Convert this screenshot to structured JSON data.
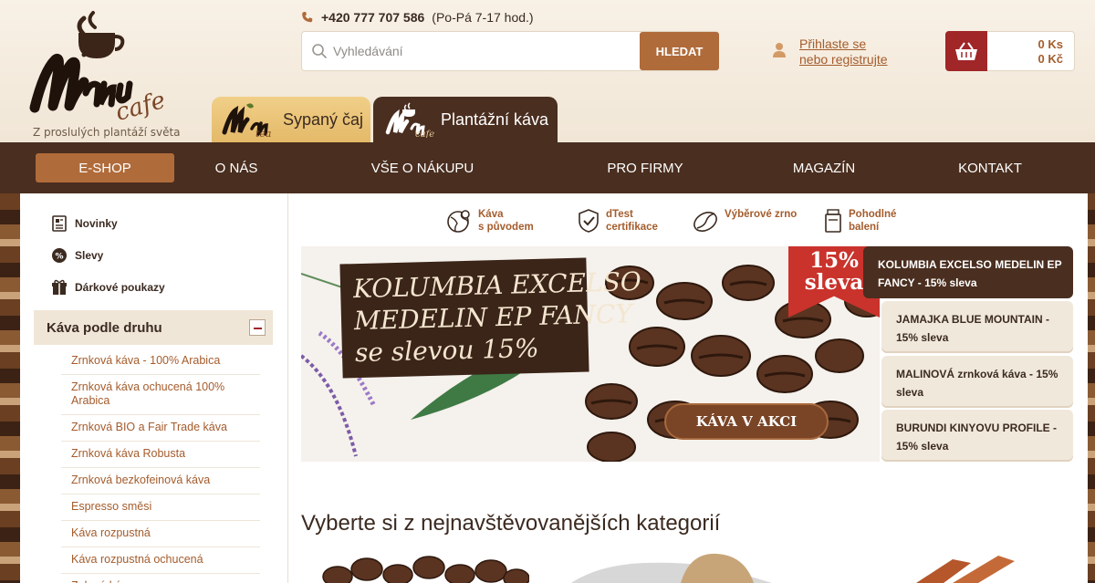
{
  "brand": {
    "tagline": "Z proslulých plantáží světa"
  },
  "contact": {
    "phone": "+420 777 707 586",
    "hours": "(Po-Pá 7-17 hod.)"
  },
  "search": {
    "placeholder": "Vyhledávání",
    "button_label": "HLEDAT"
  },
  "account": {
    "login_line1": "Přihlaste se",
    "login_line2": "nebo registrujte"
  },
  "cart": {
    "count": "0 Ks",
    "total": "0 Kč"
  },
  "tabs": [
    {
      "label": "Sypaný čaj",
      "active": false
    },
    {
      "label": "Plantážní káva",
      "active": true
    }
  ],
  "nav": [
    {
      "label": "E-SHOP",
      "active": true
    },
    {
      "label": "O NÁS",
      "active": false
    },
    {
      "label": "VŠE O NÁKUPU",
      "active": false
    },
    {
      "label": "PRO FIRMY",
      "active": false
    },
    {
      "label": "MAGAZÍN",
      "active": false
    },
    {
      "label": "KONTAKT",
      "active": false
    }
  ],
  "sidebar": {
    "links": [
      {
        "label": "Novinky",
        "icon": "newspaper-icon"
      },
      {
        "label": "Slevy",
        "icon": "percent-icon"
      },
      {
        "label": "Dárkové poukazy",
        "icon": "gift-icon"
      }
    ],
    "category_header": "Káva podle druhu",
    "categories": [
      "Zrnková káva - 100% Arabica",
      "Zrnková káva ochucená 100% Arabica",
      "Zrnková BIO a Fair Trade káva",
      "Zrnková káva Robusta",
      "Zrnková bezkofeinová káva",
      "Espresso směsi",
      "Káva rozpustná",
      "Káva rozpustná ochucená",
      "Zelená káva"
    ]
  },
  "features": [
    {
      "line1": "Káva",
      "line2": "s původem",
      "icon": "globe-pin-icon"
    },
    {
      "line1": "dTest",
      "line2": "certifikace",
      "icon": "shield-check-icon"
    },
    {
      "line1": "Výběrové zrno",
      "line2": "",
      "icon": "coffee-bean-icon"
    },
    {
      "line1": "Pohodlné",
      "line2": "balení",
      "icon": "package-icon"
    }
  ],
  "banner": {
    "title_lines": [
      "KOLUMBIA EXCELSO",
      "MEDELIN EP FANCY",
      "se slevou 15%"
    ],
    "badge_line1": "15%",
    "badge_line2": "sleva",
    "cta": "KÁVA V AKCI"
  },
  "slides": [
    {
      "label": "KOLUMBIA EXCELSO MEDELIN EP FANCY - 15% sleva",
      "active": true
    },
    {
      "label": "JAMAJKA BLUE MOUNTAIN - 15% sleva",
      "active": false
    },
    {
      "label": "MALINOVÁ zrnková káva - 15% sleva",
      "active": false
    },
    {
      "label": "BURUNDI KINYOVU PROFILE - 15% sleva",
      "active": false
    }
  ],
  "section": {
    "title": "Vyberte si z nejnavštěvovanějších kategorií"
  }
}
